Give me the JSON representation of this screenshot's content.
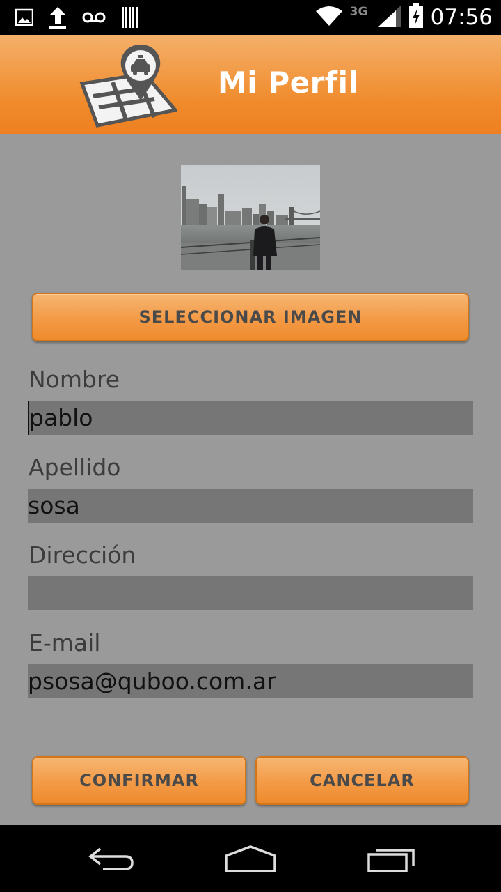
{
  "status_bar": {
    "time": "07:56",
    "network": "3G",
    "icons": [
      "image-notification-icon",
      "upload-icon",
      "voicemail-icon",
      "barcode-icon",
      "wifi-icon",
      "signal-icon",
      "battery-charging-icon"
    ]
  },
  "header": {
    "title": "Mi Perfil",
    "logo": "taxi-map-pin-logo"
  },
  "profile": {
    "photo": "profile-photo-city-skyline",
    "select_image_label": "SELECCIONAR IMAGEN"
  },
  "form": {
    "nombre": {
      "label": "Nombre",
      "value": "pablo"
    },
    "apellido": {
      "label": "Apellido",
      "value": "sosa"
    },
    "direccion": {
      "label": "Dirección",
      "value": ""
    },
    "email": {
      "label": "E-mail",
      "value": "psosa@quboo.com.ar"
    }
  },
  "actions": {
    "confirm_label": "CONFIRMAR",
    "cancel_label": "CANCELAR"
  },
  "nav_bar": {
    "icons": [
      "back-icon",
      "home-icon",
      "recent-apps-icon"
    ]
  },
  "colors": {
    "accent": "#f08a2a",
    "background": "#9a9a9a",
    "field_background": "#777677"
  }
}
